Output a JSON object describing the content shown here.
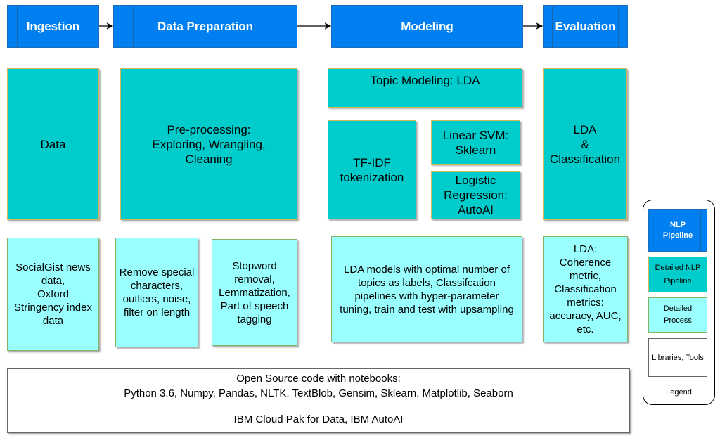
{
  "stages": [
    {
      "label": "Ingestion"
    },
    {
      "label": "Data Preparation"
    },
    {
      "label": "Modeling"
    },
    {
      "label": "Evaluation"
    }
  ],
  "pipeline": {
    "data": "Data",
    "preprocessing": "Pre-processing:\nExploring, Wrangling,\nCleaning",
    "topic_modeling": "Topic Modeling: LDA",
    "tfidf": "TF-IDF\ntokenization",
    "linear_svm": "Linear SVM:\nSklearn",
    "logistic_regression": "Logistic\nRegression:\nAutoAI",
    "evaluation": "LDA\n&\nClassification"
  },
  "process": {
    "ingestion": "SocialGist news\ndata,\nOxford\nStringency index\ndata",
    "cleaning": "Remove special\ncharacters,\noutliers, noise,\nfilter on length",
    "nlp": "Stopword\nremoval,\nLemmatization,\nPart of speech\ntagging",
    "modeling": "LDA models with optimal number of\ntopics as labels, Classifcation\npipelines with hyper-parameter\ntuning, train and test with upsampling",
    "evaluation": "LDA:\nCoherence\nmetric,\nClassification\nmetrics:\naccuracy, AUC,\netc."
  },
  "tools": {
    "line1": "Open Source code with notebooks:",
    "line2": "Python 3.6, Numpy, Pandas, NLTK, TextBlob, Gensim, Sklearn, Matplotlib, Seaborn",
    "line3": "IBM Cloud Pak for Data, IBM AutoAI"
  },
  "legend": {
    "title": "Legend",
    "nlp_pipeline": "NLP\nPipeline",
    "detailed_nlp_pipeline": "Detailed NLP\nPipeline",
    "detailed_process": "Detailed\nProcess",
    "libraries_tools": "Libraries, Tools"
  },
  "colors": {
    "stage_blue": "#0080f0",
    "pipeline_teal": "#00cccc",
    "process_light": "#99ffff",
    "tools_white": "#ffffff"
  }
}
